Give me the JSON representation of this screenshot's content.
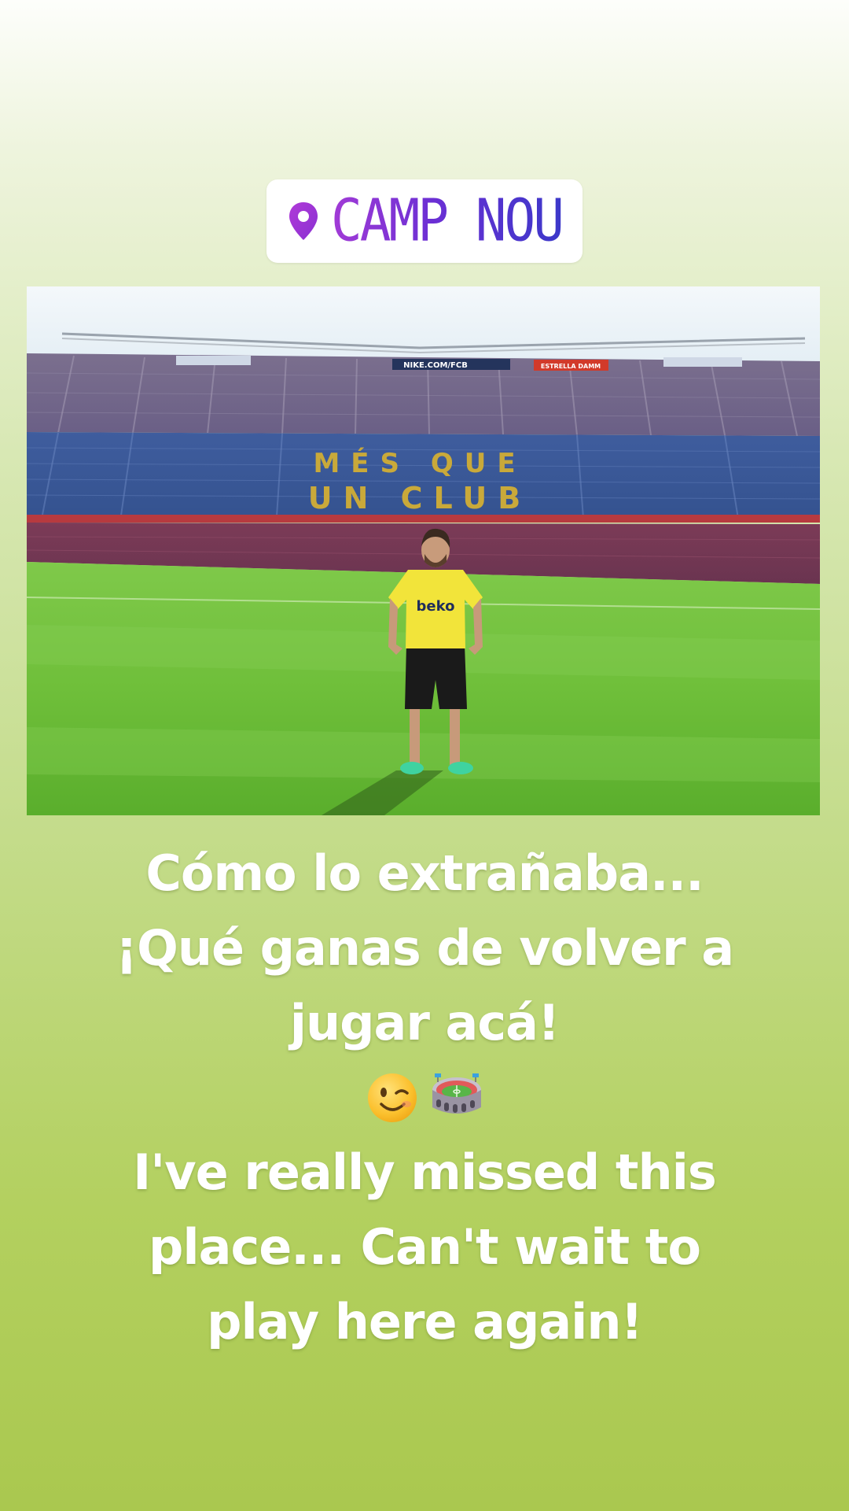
{
  "location": {
    "name": "CAMP NOU",
    "icon": "location-pin-icon"
  },
  "photo": {
    "banners": {
      "center": "NIKE.COM/FCB",
      "right": "ESTRELLA DAMM"
    },
    "stand_text": {
      "top": "MÉS QUE",
      "bottom": "UN CLUB"
    },
    "shirt_sponsor": "beko"
  },
  "caption": {
    "spanish_lines": [
      "Cómo lo extrañaba...",
      "¡Qué ganas de volver a",
      "jugar acá!"
    ],
    "emojis": [
      "winking-face",
      "stadium"
    ],
    "english_lines": [
      "I've really missed this",
      "place... Can't wait to",
      "play here again!"
    ]
  },
  "colors": {
    "location_gradient_start": "#a23bd6",
    "location_gradient_end": "#3c38c9",
    "background_top": "#fdfefb",
    "background_bottom": "#aac84f",
    "caption_text": "#ffffff"
  }
}
